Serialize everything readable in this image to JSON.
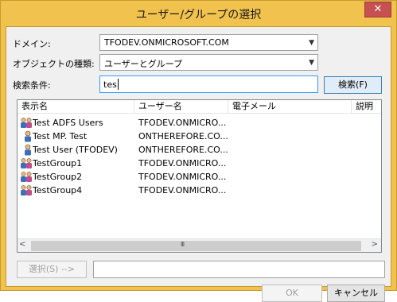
{
  "window": {
    "title": "ユーザー/グループの選択",
    "close_glyph": "✕"
  },
  "form": {
    "domain_label": "ドメイン:",
    "domain_value": "TFODEV.ONMICROSOFT.COM",
    "object_type_label": "オブジェクトの種類:",
    "object_type_value": "ユーザーとグループ",
    "search_label": "検索条件:",
    "search_value": "tes",
    "search_button": "検索(F)"
  },
  "results": {
    "columns": [
      "表示名",
      "ユーザー名",
      "電子メール",
      "説明"
    ],
    "rows": [
      {
        "icon": "group-icon",
        "display_name": "Test ADFS Users",
        "user_name": "TFODEV.ONMICRO..."
      },
      {
        "icon": "user-icon",
        "display_name": "Test MP. Test",
        "user_name": "ONTHEREFORE.CO..."
      },
      {
        "icon": "user-icon",
        "display_name": "Test User (TFODEV)",
        "user_name": "ONTHEREFORE.CO..."
      },
      {
        "icon": "group-icon",
        "display_name": "TestGroup1",
        "user_name": "TFODEV.ONMICRO..."
      },
      {
        "icon": "group-icon",
        "display_name": "TestGroup2",
        "user_name": "TFODEV.ONMICRO..."
      },
      {
        "icon": "group-icon",
        "display_name": "TestGroup4",
        "user_name": "TFODEV.ONMICRO..."
      }
    ],
    "scroll_left": "<",
    "scroll_right": ">",
    "scroll_grip": "III"
  },
  "footer": {
    "select_button": "選択(S) -->",
    "selected_value": "",
    "ok_button": "OK",
    "cancel_button": "キャンセル"
  },
  "colors": {
    "title_bar": "#f2c24e",
    "selection_border": "#3399ff"
  }
}
